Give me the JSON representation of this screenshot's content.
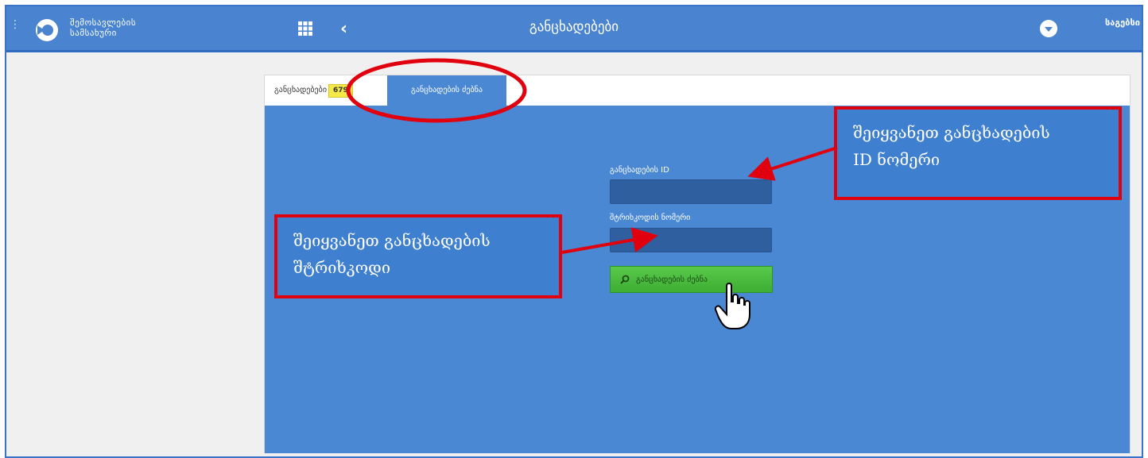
{
  "header": {
    "org_line1": "შემოსავლების",
    "org_line2": "სამსახური",
    "title": "განცხადებები",
    "user_name": "საგებსი"
  },
  "tabs": {
    "list_label": "განცხადებები",
    "list_count": "679",
    "search_label": "განცხადების ძებნა"
  },
  "form": {
    "id_label": "განცხადების ID",
    "id_value": "",
    "barcode_label": "შტრიხკოდის ნომერი",
    "barcode_value": "",
    "search_button": "განცხადების ძებნა"
  },
  "annotations": {
    "id_hint_line1": "შეიყვანეთ განცხადების",
    "id_hint_line2": "ID ნომერი",
    "barcode_hint_line1": "შეიყვანეთ განცხადების",
    "barcode_hint_line2": "შტრიხკოდი"
  },
  "colors": {
    "header": "#4a84d0",
    "content": "#4a88d4",
    "button": "#4cba3f",
    "badge": "#f5e94a",
    "annotation_border": "#e0000e"
  }
}
